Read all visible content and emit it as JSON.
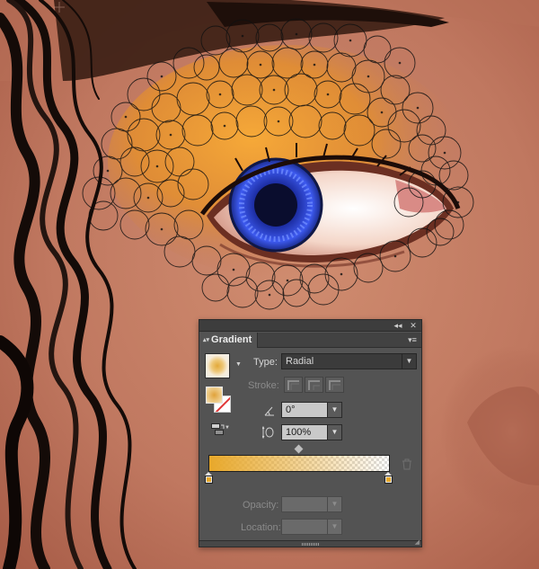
{
  "panel": {
    "tab_title": "Gradient",
    "topbar": {
      "collapse_glyph": "◂◂",
      "close_glyph": "✕",
      "menu_glyph": "▾≡"
    },
    "type": {
      "label": "Type:",
      "value": "Radial"
    },
    "stroke": {
      "label": "Stroke:"
    },
    "angle": {
      "value": "0°"
    },
    "aspect_ratio": {
      "value": "100%"
    },
    "opacity": {
      "label": "Opacity:",
      "value": ""
    },
    "location": {
      "label": "Location:",
      "value": ""
    },
    "gradient": {
      "start_color": "#e8a82a",
      "end_color": "#ffffff",
      "end_opacity": 0,
      "midpoint_percent": 50
    },
    "icons": [
      "gradient-thumbnail-icon",
      "fill-swatch-icon",
      "stroke-swatch-icon",
      "reverse-gradient-icon",
      "angle-icon",
      "aspect-ratio-icon",
      "trash-icon",
      "collapse-icon",
      "close-icon",
      "panel-menu-icon"
    ]
  }
}
